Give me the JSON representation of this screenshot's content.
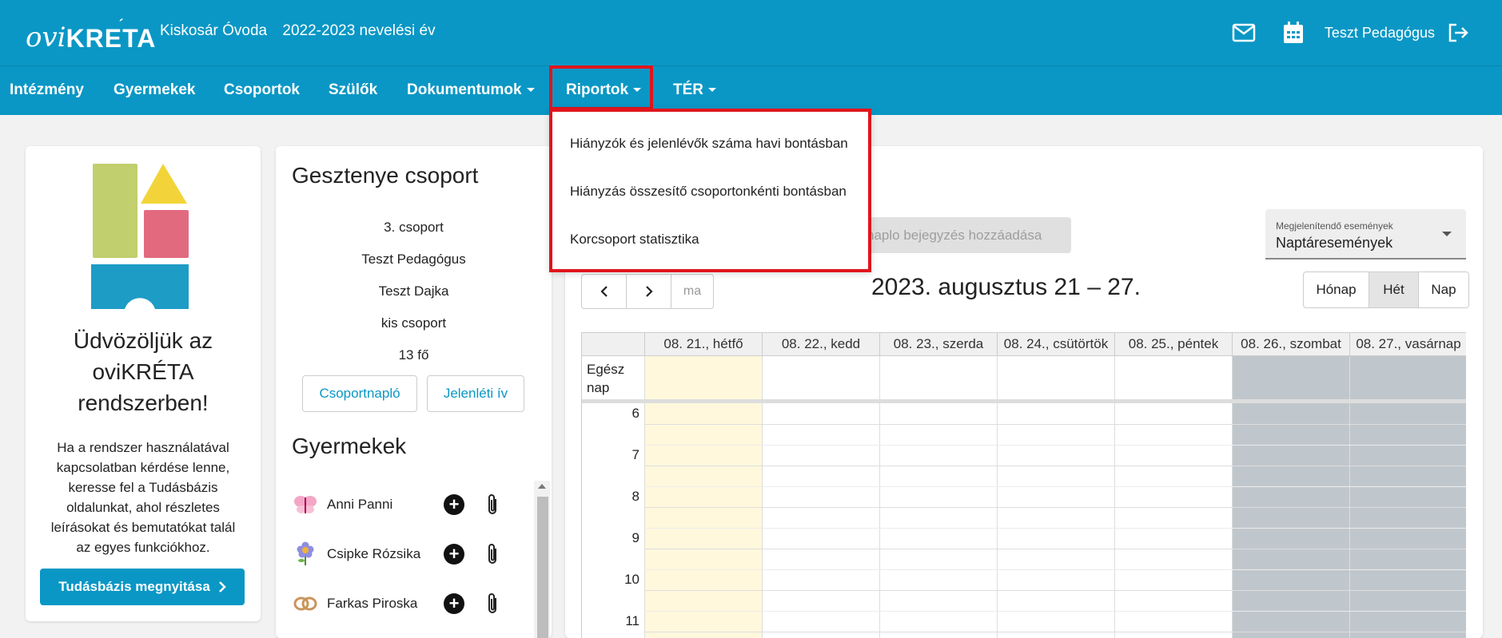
{
  "header": {
    "logo_ovi": "ovi",
    "logo_kreta": "KRETA",
    "logo_accent": "´",
    "institution": "Kiskosár Óvoda",
    "school_year": "2022-2023 nevelési év",
    "user_name": "Teszt Pedagógus",
    "icons": [
      "mail-icon",
      "calendar-icon",
      "logout-icon"
    ]
  },
  "nav": {
    "items": [
      {
        "label": "Intézmény",
        "dropdown": false
      },
      {
        "label": "Gyermekek",
        "dropdown": false
      },
      {
        "label": "Csoportok",
        "dropdown": false
      },
      {
        "label": "Szülők",
        "dropdown": false
      },
      {
        "label": "Dokumentumok",
        "dropdown": true
      },
      {
        "label": "Riportok",
        "dropdown": true
      },
      {
        "label": "TÉR",
        "dropdown": true
      }
    ],
    "riportok_menu": [
      "Hiányzók és jelenlévők száma havi bontásban",
      "Hiányzás összesítő csoportonkénti bontásban",
      "Korcsoport statisztika"
    ]
  },
  "welcome_card": {
    "title_line1": "Üdvözöljük az",
    "title_line2": "oviKRÉTA",
    "title_line3": "rendszerben!",
    "help_lines": [
      "Ha a rendszer használatával",
      "kapcsolatban kérdése lenne,",
      "keresse fel a Tudásbázis",
      "oldalunkat, ahol részletes",
      "leírásokat és bemutatókat talál",
      "az egyes funkciókhoz."
    ],
    "kb_button": "Tudásbázis megnyitása",
    "colors": {
      "green": "#c2cf6e",
      "yellow": "#f2d43a",
      "pink": "#e26a7f",
      "blue": "#1d9cc6"
    }
  },
  "group_card": {
    "title": "Gesztenye csoport",
    "info": [
      "3. csoport",
      "Teszt Pedagógus",
      "Teszt Dajka",
      "kis csoport",
      "13 fő"
    ],
    "btn_journal": "Csoportnapló",
    "btn_attendance": "Jelenléti ív",
    "kids_title": "Gyermekek",
    "kids": [
      {
        "name": "Anni Panni",
        "icon": "butterfly-icon"
      },
      {
        "name": "Csipke Rózsika",
        "icon": "flower-icon"
      },
      {
        "name": "Farkas Piroska",
        "icon": "pretzel-icon"
      }
    ]
  },
  "calendar": {
    "add_entry": "naplo bejegyzés hozzáadása",
    "events_label": "Megjelenítendő események",
    "events_value": "Naptáresemények",
    "today_btn": "ma",
    "week_title": "2023. augusztus 21 – 27.",
    "views": [
      "Hónap",
      "Hét",
      "Nap"
    ],
    "active_view": "Hét",
    "allday_label_1": "Egész",
    "allday_label_2": "nap",
    "days": [
      {
        "label": "08. 21., hétfő",
        "today": true,
        "weekend": false
      },
      {
        "label": "08. 22., kedd",
        "today": false,
        "weekend": false
      },
      {
        "label": "08. 23., szerda",
        "today": false,
        "weekend": false
      },
      {
        "label": "08. 24., csütörtök",
        "today": false,
        "weekend": false
      },
      {
        "label": "08. 25., péntek",
        "today": false,
        "weekend": false
      },
      {
        "label": "08. 26., szombat",
        "today": false,
        "weekend": true
      },
      {
        "label": "08. 27., vasárnap",
        "today": false,
        "weekend": true
      }
    ],
    "hours": [
      "6",
      "7",
      "8",
      "9",
      "10",
      "11"
    ],
    "colors": {
      "today": "#fff8dc",
      "weekend": "#c0c7cc",
      "accent": "#0a97c5"
    }
  }
}
